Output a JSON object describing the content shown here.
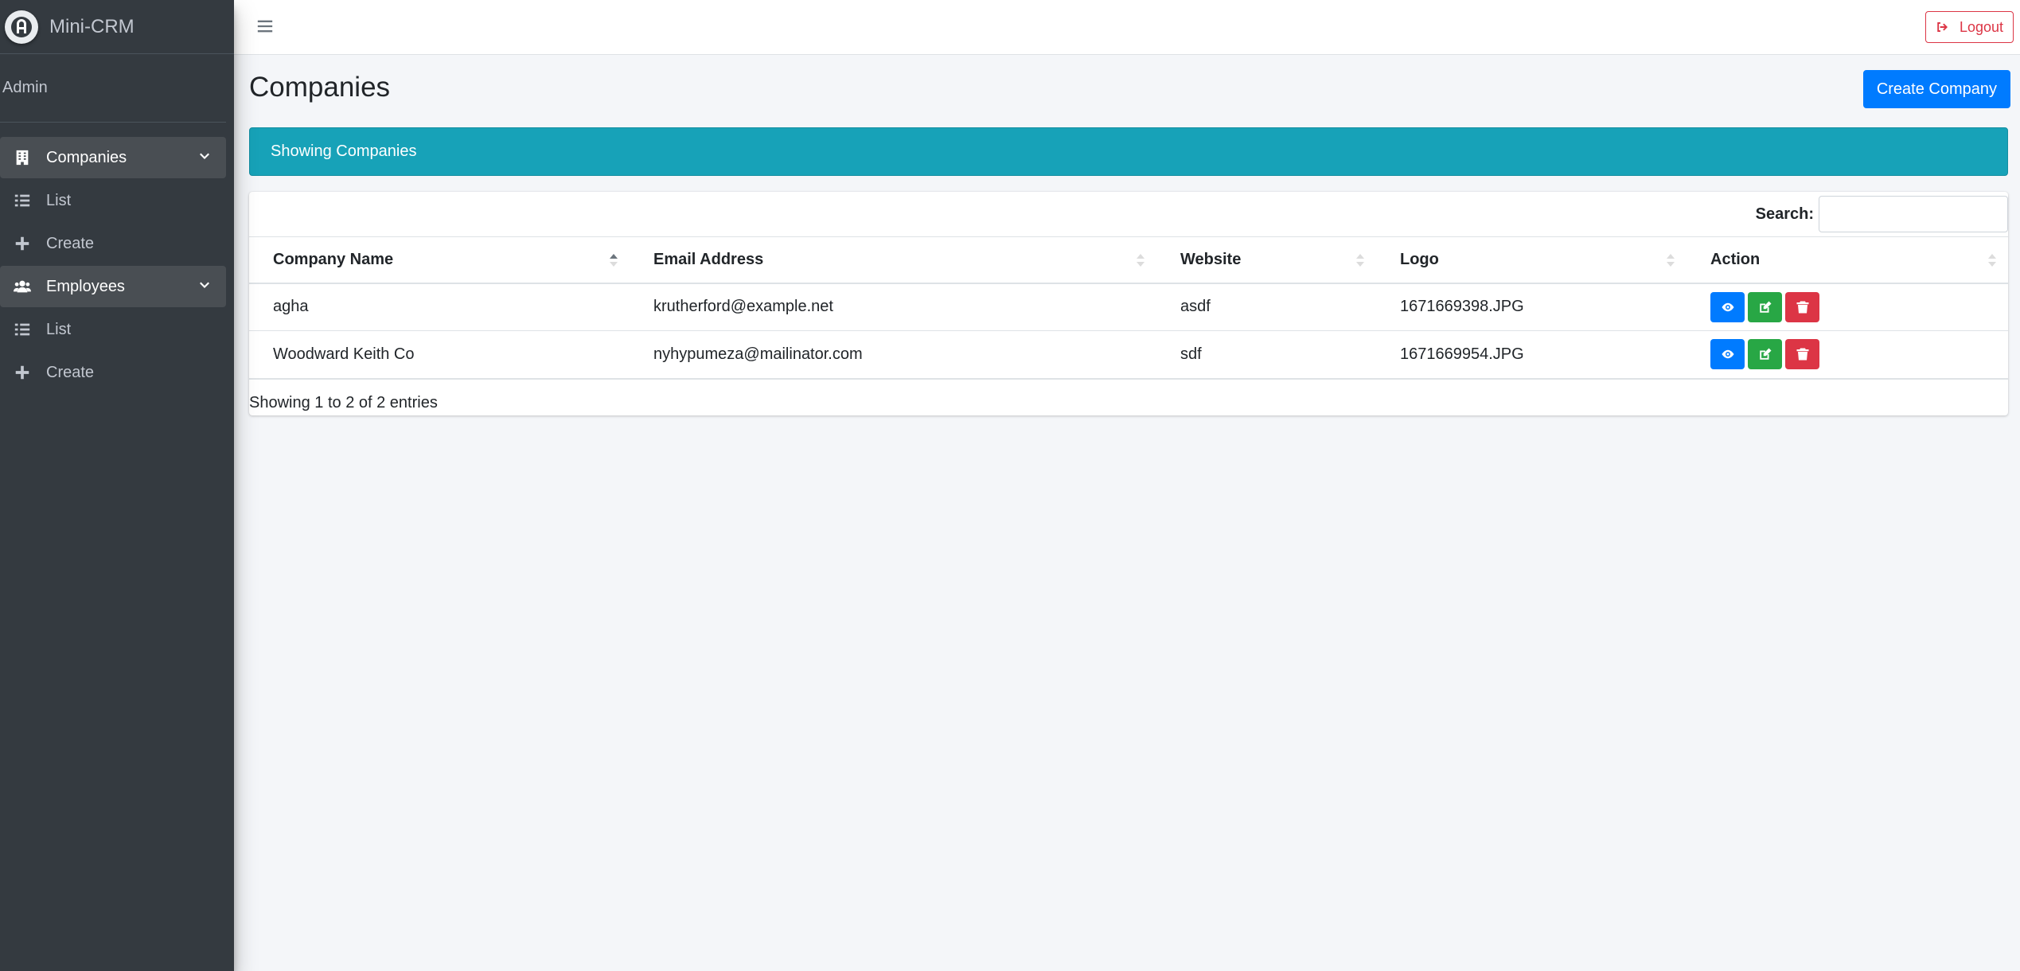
{
  "brand": {
    "name": "Mini-CRM",
    "logo_icon": "brand-logo-icon"
  },
  "user": {
    "name": "Admin"
  },
  "sidebar": {
    "items": [
      {
        "label": "Companies",
        "icon": "building-icon",
        "type": "parent"
      },
      {
        "label": "List",
        "icon": "list-icon",
        "type": "child"
      },
      {
        "label": "Create",
        "icon": "plus-icon",
        "type": "child"
      },
      {
        "label": "Employees",
        "icon": "users-icon",
        "type": "parent"
      },
      {
        "label": "List",
        "icon": "list-icon",
        "type": "child"
      },
      {
        "label": "Create",
        "icon": "plus-icon",
        "type": "child"
      }
    ]
  },
  "topbar": {
    "logout_label": "Logout"
  },
  "page": {
    "title": "Companies",
    "create_label": "Create Company",
    "banner": "Showing Companies"
  },
  "table": {
    "search_label": "Search:",
    "search_value": "",
    "columns": [
      "Company Name",
      "Email Address",
      "Website",
      "Logo",
      "Action"
    ],
    "rows": [
      {
        "name": "agha",
        "email": "krutherford@example.net",
        "website": "asdf",
        "logo": "1671669398.JPG"
      },
      {
        "name": "Woodward Keith Co",
        "email": "nyhypumeza@mailinator.com",
        "website": "sdf",
        "logo": "1671669954.JPG"
      }
    ],
    "info": "Showing 1 to 2 of 2 entries"
  },
  "colors": {
    "sidebar_bg": "#343a40",
    "primary": "#007bff",
    "success": "#28a745",
    "danger": "#dc3545",
    "info": "#17a2b8"
  }
}
